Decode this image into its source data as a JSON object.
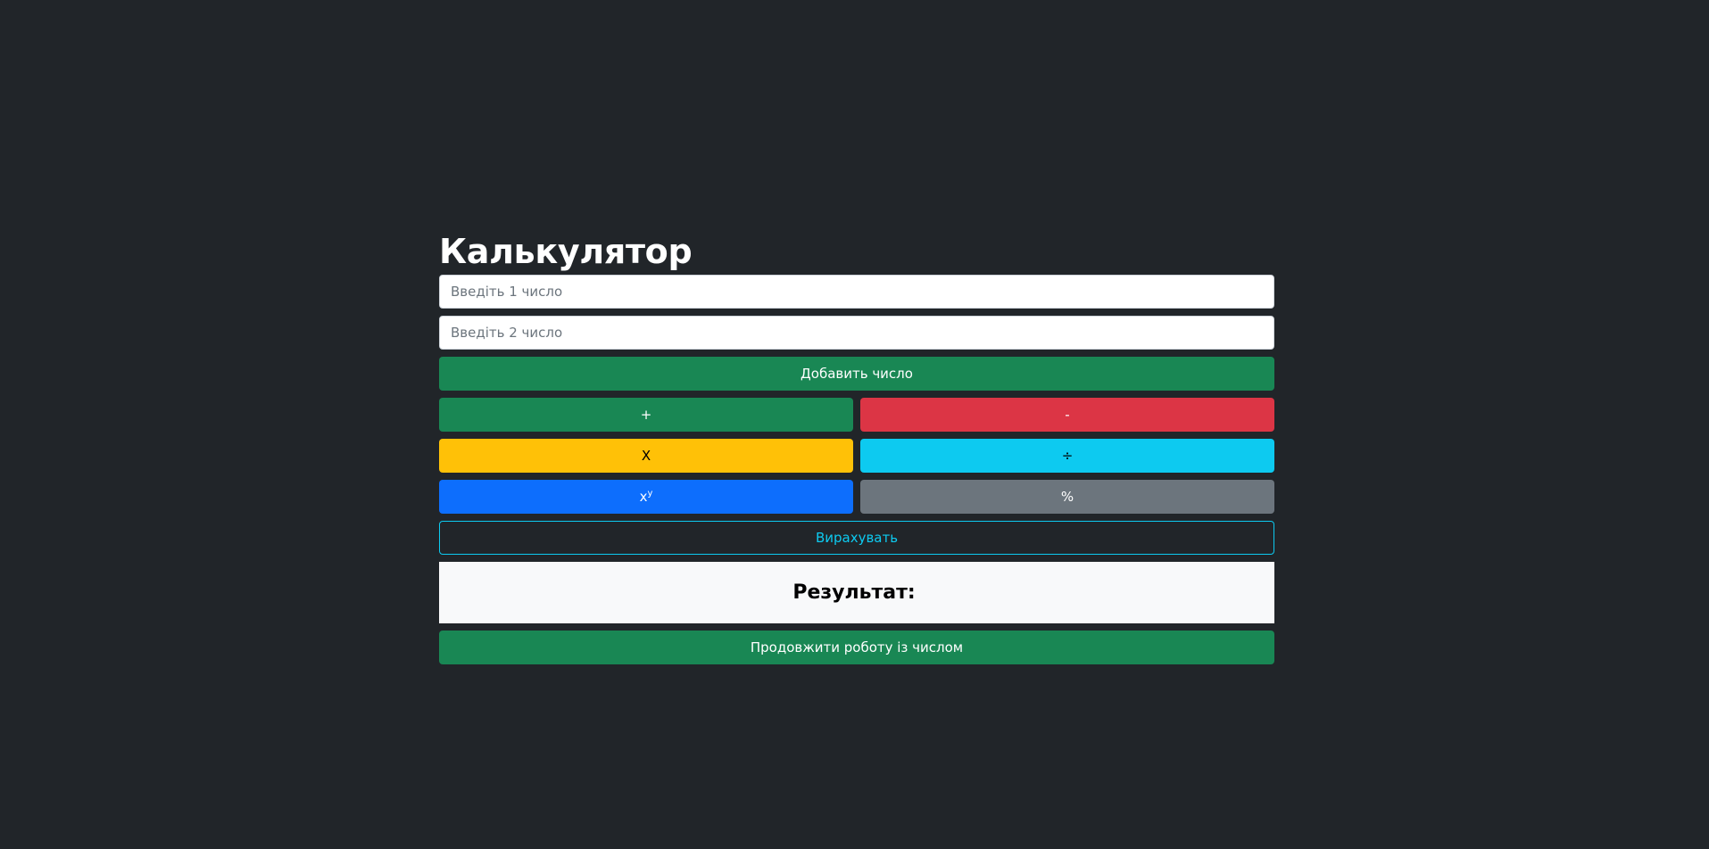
{
  "calculator": {
    "title": "Калькулятор",
    "input1": {
      "placeholder": "Введіть 1 число",
      "value": ""
    },
    "input2": {
      "placeholder": "Введіть 2 число",
      "value": ""
    },
    "add_number_label": "Добавить число",
    "ops": {
      "plus": "+",
      "minus": "-",
      "multiply": "X",
      "divide": "÷",
      "power_base": "x",
      "power_exp": "y",
      "percent": "%"
    },
    "calculate_label": "Вирахувать",
    "result_label": "Результат:",
    "result_value": "",
    "continue_label": "Продовжити роботу із числом"
  },
  "colors": {
    "background": "#212529",
    "success": "#198754",
    "danger": "#dc3545",
    "warning": "#ffc107",
    "info": "#0dcaf0",
    "primary": "#0d6efd",
    "secondary": "#6c757d",
    "light": "#f8f9fa"
  }
}
